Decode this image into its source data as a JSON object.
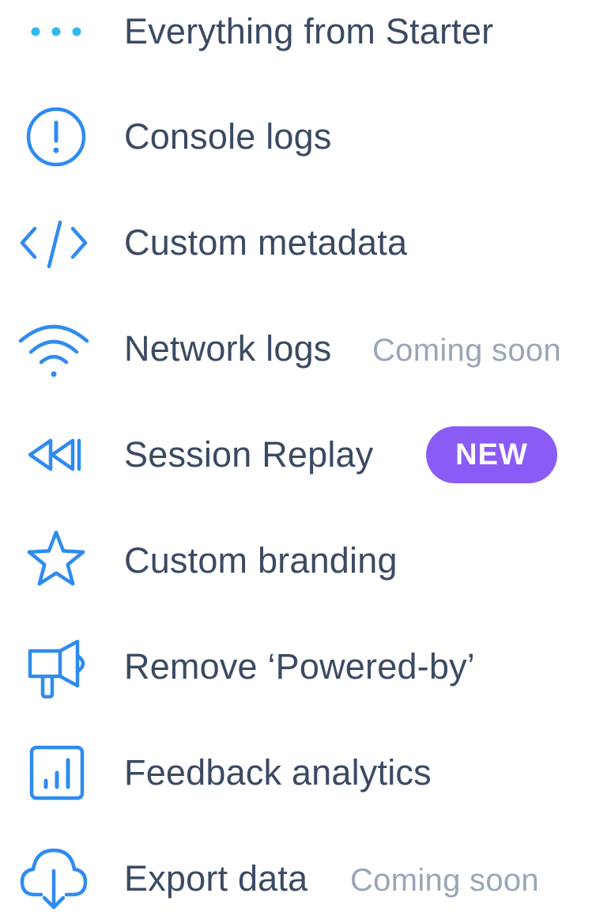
{
  "colors": {
    "icon": "#2f8bf0",
    "dots": "#33b9ee",
    "text": "#3b4a63",
    "muted": "#9aa6b8",
    "badge": "#8a5cf5"
  },
  "features": [
    {
      "icon": "ellipsis-icon",
      "label": "Everything from Starter"
    },
    {
      "icon": "exclamation-circle-icon",
      "label": "Console logs"
    },
    {
      "icon": "code-icon",
      "label": "Custom metadata"
    },
    {
      "icon": "wifi-icon",
      "label": "Network logs",
      "note": "Coming soon"
    },
    {
      "icon": "rewind-icon",
      "label": "Session Replay",
      "badge": "NEW"
    },
    {
      "icon": "star-icon",
      "label": "Custom branding"
    },
    {
      "icon": "megaphone-icon",
      "label": "Remove ‘Powered-by’"
    },
    {
      "icon": "bar-chart-icon",
      "label": "Feedback analytics"
    },
    {
      "icon": "cloud-download-icon",
      "label": "Export data",
      "note": "Coming soon"
    }
  ]
}
